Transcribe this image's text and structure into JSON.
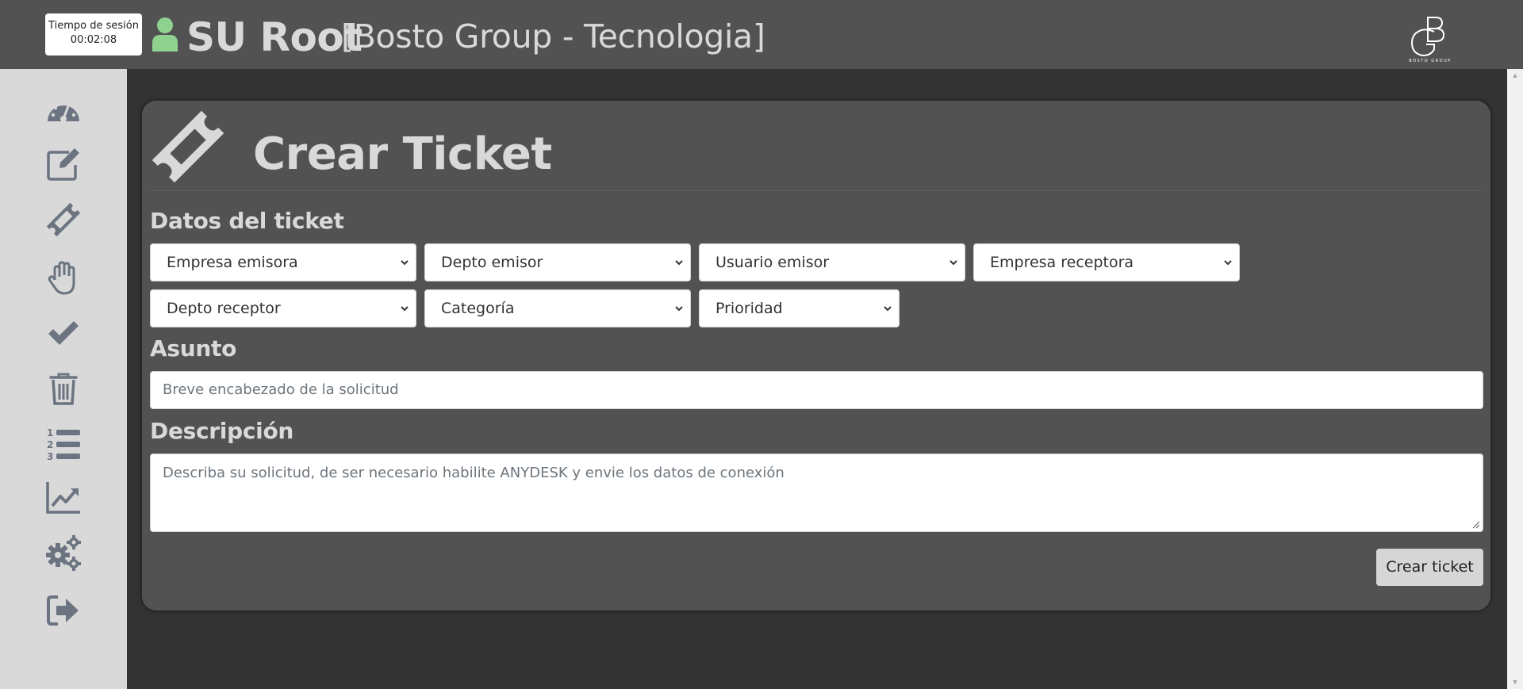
{
  "header": {
    "session_label": "Tiempo de sesión",
    "session_time": "00:02:08",
    "user_name": "SU Root",
    "user_company": "[Bosto Group - Tecnologia]",
    "logo_text": "BOSTO GROUP"
  },
  "sidebar": {
    "items": [
      {
        "icon": "dashboard-gauge-icon"
      },
      {
        "icon": "edit-icon"
      },
      {
        "icon": "ticket-icon"
      },
      {
        "icon": "hand-icon"
      },
      {
        "icon": "check-icon"
      },
      {
        "icon": "trash-icon"
      },
      {
        "icon": "numbered-list-icon"
      },
      {
        "icon": "chart-line-icon"
      },
      {
        "icon": "settings-gears-icon"
      },
      {
        "icon": "sign-out-icon"
      }
    ]
  },
  "card": {
    "title": "Crear Ticket",
    "section_data": "Datos del ticket",
    "selects": {
      "empresa_emisora": "Empresa emisora",
      "depto_emisor": "Depto emisor",
      "usuario_emisor": "Usuario emisor",
      "empresa_receptora": "Empresa receptora",
      "depto_receptor": "Depto receptor",
      "categoria": "Categoría",
      "prioridad": "Prioridad"
    },
    "asunto_label": "Asunto",
    "asunto_placeholder": "Breve encabezado de la solicitud",
    "descripcion_label": "Descripción",
    "descripcion_placeholder": "Describa su solicitud, de ser necesario habilite ANYDESK y envie los datos de conexión",
    "submit_label": "Crear ticket"
  },
  "colors": {
    "header_bg": "#525252",
    "page_bg": "#333333",
    "sidebar_bg": "#d9d9d9",
    "card_bg": "#525252",
    "icon_gray": "#6b7480",
    "user_icon_green": "#8fd18f",
    "text_light": "#d9d9d9"
  }
}
